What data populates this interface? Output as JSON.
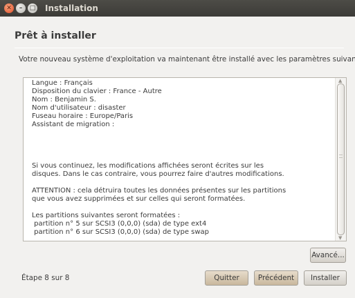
{
  "window": {
    "title": "Installation",
    "controls": [
      "close-icon",
      "minimize-icon",
      "maximize-icon"
    ]
  },
  "page": {
    "heading": "Prêt à installer",
    "intro": "Votre nouveau système d'exploitation va maintenant être installé avec les paramètres suivants :"
  },
  "summary": {
    "text": "Langue : Français\nDisposition du clavier : France - Autre\nNom : Benjamin S.\nNom d'utilisateur : disaster\nFuseau horaire : Europe/Paris\nAssistant de migration :\n\n\n\n\nSi vous continuez, les modifications affichées seront écrites sur les\ndisques. Dans le cas contraire, vous pourrez faire d'autres modifications.\n\nATTENTION : cela détruira toutes les données présentes sur les partitions\nque vous avez supprimées et sur celles qui seront formatées.\n\nLes partitions suivantes seront formatées :\n partition n° 5 sur SCSI3 (0,0,0) (sda) de type ext4\n partition n° 6 sur SCSI3 (0,0,0) (sda) de type swap"
  },
  "buttons": {
    "advanced": "Avancé...",
    "quit": "Quitter",
    "previous": "Précédent",
    "install": "Installer"
  },
  "footer": {
    "step": "Étape 8 sur 8"
  },
  "colors": {
    "titlebar": "#3c3b37",
    "close_button": "#e0502a",
    "accent_buttons": "#c9b89d"
  }
}
